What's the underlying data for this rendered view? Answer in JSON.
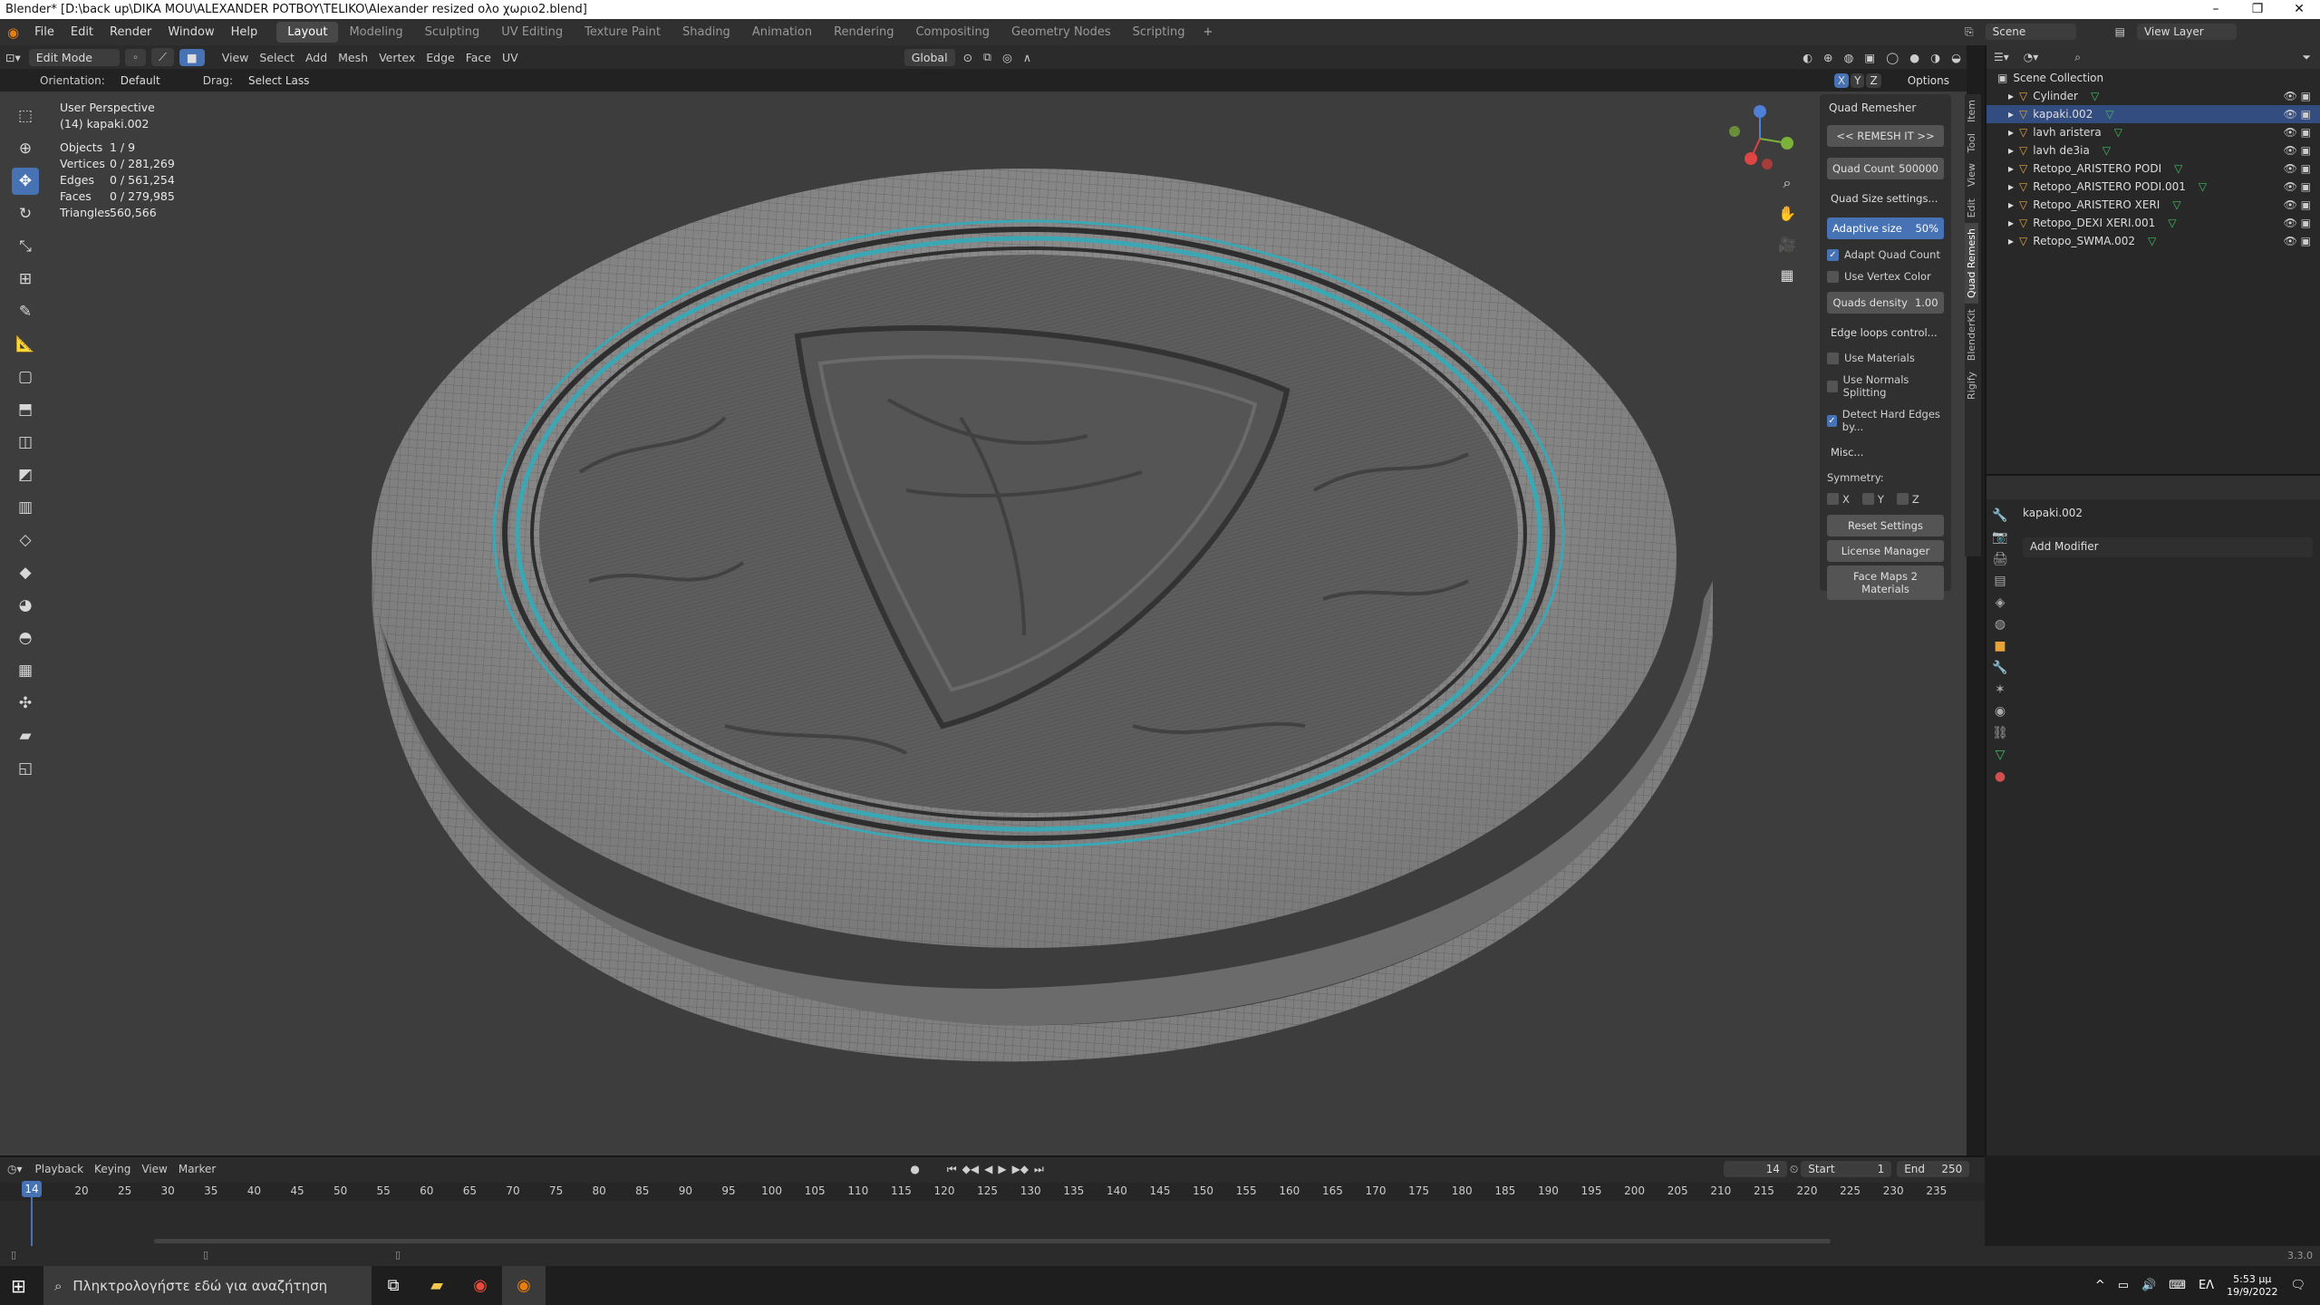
{
  "window": {
    "title": "Blender* [D:\\back up\\DIKA MOU\\ALEXANDER POTBOY\\TELIKO\\Alexander resized  ολο χωριο2.blend]"
  },
  "menu": [
    "File",
    "Edit",
    "Render",
    "Window",
    "Help"
  ],
  "workspaces": [
    "Layout",
    "Modeling",
    "Sculpting",
    "UV Editing",
    "Texture Paint",
    "Shading",
    "Animation",
    "Rendering",
    "Compositing",
    "Geometry Nodes",
    "Scripting"
  ],
  "active_workspace": "Layout",
  "scene": {
    "name": "Scene",
    "view_layer": "View Layer"
  },
  "viewport_header": {
    "mode": "Edit Mode",
    "menus": [
      "View",
      "Select",
      "Add",
      "Mesh",
      "Vertex",
      "Edge",
      "Face",
      "UV"
    ],
    "transform_orientation": "Global",
    "orientation_label": "Orientation:",
    "orientation_value": "Default",
    "drag_label": "Drag:",
    "drag_value": "Select Lass",
    "options": "Options",
    "axes": [
      "X",
      "Y",
      "Z"
    ]
  },
  "overlay_stats": {
    "view": "User Perspective",
    "object": "(14) kapaki.002",
    "rows": [
      {
        "k": "Objects",
        "v": "1 / 9"
      },
      {
        "k": "Vertices",
        "v": "0 / 281,269"
      },
      {
        "k": "Edges",
        "v": "0 / 561,254"
      },
      {
        "k": "Faces",
        "v": "0 / 279,985"
      },
      {
        "k": "Triangles",
        "v": "560,566"
      }
    ]
  },
  "quad_remesher": {
    "title": "Quad Remesher",
    "remesh_button": "<< REMESH IT >>",
    "quad_count_label": "Quad Count",
    "quad_count_value": "500000",
    "quad_size_settings": "Quad Size settings...",
    "adaptive_size_label": "Adaptive size",
    "adaptive_size_value": "50%",
    "adapt_quad_count": "Adapt Quad Count",
    "use_vertex_color": "Use Vertex Color",
    "quads_density_label": "Quads density",
    "quads_density_value": "1.00",
    "edge_loops_control": "Edge loops control...",
    "use_materials": "Use Materials",
    "use_normals_splitting": "Use Normals Splitting",
    "detect_hard_edges": "Detect Hard Edges by...",
    "misc": "Misc...",
    "symmetry": "Symmetry:",
    "sym_axes": [
      "X",
      "Y",
      "Z"
    ],
    "reset_settings": "Reset Settings",
    "license_manager": "License Manager",
    "face_maps": "Face Maps 2 Materials"
  },
  "n_tabs": [
    "Item",
    "Tool",
    "View",
    "Edit",
    "Quad Remesh",
    "BlenderKit",
    "Rigify"
  ],
  "outliner": {
    "root": "Scene Collection",
    "items": [
      "Cylinder",
      "kapaki.002",
      "lavh aristera",
      "lavh de3ia",
      "Retopo_ARISTERO PODI",
      "Retopo_ARISTERO PODI.001",
      "Retopo_ARISTERO XERI",
      "Retopo_DEXI XERI.001",
      "Retopo_SWMA.002"
    ],
    "selected": "kapaki.002"
  },
  "properties": {
    "object_name": "kapaki.002",
    "add_modifier": "Add Modifier"
  },
  "timeline": {
    "menus": [
      "Playback",
      "Keying",
      "View",
      "Marker"
    ],
    "current_frame": "14",
    "start_label": "Start",
    "start": "1",
    "end_label": "End",
    "end": "250",
    "ticks": [
      "20",
      "25",
      "30",
      "35",
      "40",
      "45",
      "50",
      "55",
      "60",
      "65",
      "70",
      "75",
      "80",
      "85",
      "90",
      "95",
      "100",
      "105",
      "110",
      "115",
      "120",
      "125",
      "130",
      "135",
      "140",
      "145",
      "150",
      "155",
      "160",
      "165",
      "170",
      "175",
      "180",
      "185",
      "190",
      "195",
      "200",
      "205",
      "210",
      "215",
      "220",
      "225",
      "230",
      "235"
    ]
  },
  "status": {
    "version": "3.3.0"
  },
  "taskbar": {
    "search_placeholder": "Πληκτρολογήστε εδώ για αναζήτηση",
    "lang": "ΕΛ",
    "time": "5:53 μμ",
    "date": "19/9/2022"
  },
  "colors": {
    "accent": "#4772b3",
    "mesh_teal": "#3aa7b5"
  }
}
